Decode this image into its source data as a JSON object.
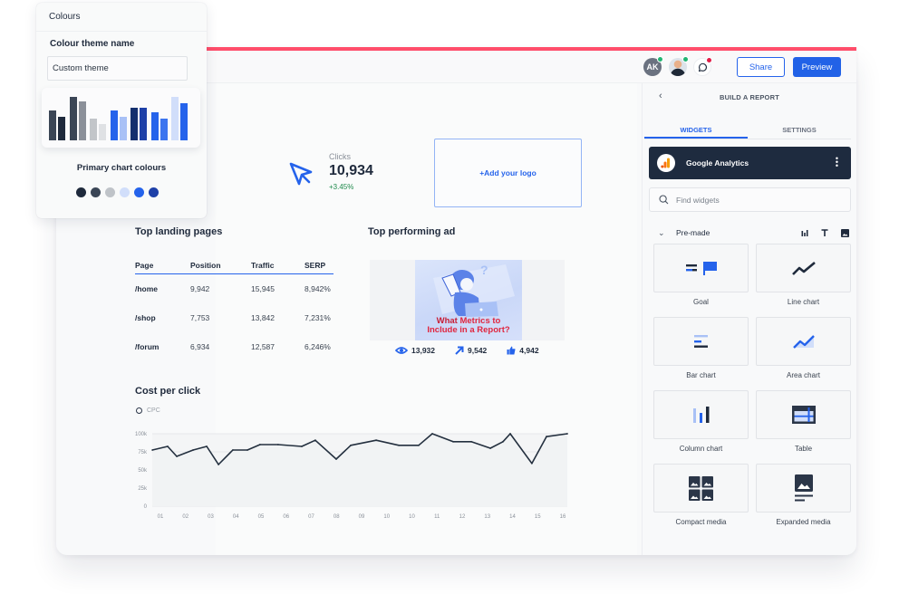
{
  "colours_panel": {
    "title": "Colours",
    "theme_name_label": "Colour theme name",
    "theme_name_value": "Custom theme",
    "preview_bars": [
      {
        "value": 0.5,
        "color": "#3b4656"
      },
      {
        "value": 0.4,
        "color": "#1f2a3c"
      },
      {
        "value": 0.73,
        "color": "#3b4656"
      },
      {
        "value": 0.66,
        "color": "#8b9099"
      },
      {
        "value": 0.36,
        "color": "#c2c5c9"
      },
      {
        "value": 0.28,
        "color": "#dfe1e4"
      },
      {
        "value": 0.5,
        "color": "#2563eb"
      },
      {
        "value": 0.4,
        "color": "#a9c1f6"
      },
      {
        "value": 0.55,
        "color": "#14306e"
      },
      {
        "value": 0.55,
        "color": "#1e40a8"
      },
      {
        "value": 0.47,
        "color": "#2563eb"
      },
      {
        "value": 0.37,
        "color": "#3b74ef"
      },
      {
        "value": 0.73,
        "color": "#d1defa"
      },
      {
        "value": 0.63,
        "color": "#2563eb"
      }
    ],
    "primary_label": "Primary chart colours",
    "swatches": [
      "#1f2a3c",
      "#3b4656",
      "#bfc3c8",
      "#d1defa",
      "#2563eb",
      "#1e40a8"
    ]
  },
  "header": {
    "avatar_initials": "AK",
    "share_label": "Share",
    "preview_label": "Preview",
    "accent_color": "#ff4d6a"
  },
  "kpi": {
    "icon": "cursor-icon",
    "label": "Clicks",
    "value": "10,934",
    "change": "+3.45%"
  },
  "logo_placeholder": "+Add your logo",
  "landing_pages": {
    "title": "Top landing pages",
    "columns": [
      "Page",
      "Position",
      "Traffic",
      "SERP"
    ],
    "rows": [
      [
        "/home",
        "9,942",
        "15,945",
        "8,942%"
      ],
      [
        "/shop",
        "7,753",
        "13,842",
        "7,231%"
      ],
      [
        "/forum",
        "6,934",
        "12,587",
        "6,246%"
      ]
    ]
  },
  "top_ad": {
    "title": "Top performing ad",
    "image_text_line1_a": "What ",
    "image_text_line1_b": "Metrics to",
    "image_text_line2": "Include in a Report?",
    "stats": [
      {
        "icon": "eye-icon",
        "value": "13,932"
      },
      {
        "icon": "arrow-up-right-icon",
        "value": "9,542"
      },
      {
        "icon": "thumbs-up-icon",
        "value": "4,942"
      }
    ]
  },
  "chart_data": {
    "type": "line",
    "title": "Cost per click",
    "legend": [
      "CPC"
    ],
    "legend_position": "top-left",
    "xlabel": "",
    "ylabel": "",
    "categories": [
      "01",
      "02",
      "03",
      "04",
      "05",
      "06",
      "07",
      "08",
      "09",
      "10",
      "10",
      "11",
      "12",
      "13",
      "14",
      "15",
      "16"
    ],
    "y_ticks": [
      "0",
      "25k",
      "50k",
      "75k",
      "100k"
    ],
    "ylim": [
      0,
      100000
    ],
    "grid": true,
    "series": [
      {
        "name": "CPC",
        "x": [
          -0.32,
          0.29,
          0.65,
          1.3,
          1.84,
          2.31,
          2.88,
          3.46,
          3.96,
          4.68,
          5.62,
          6.16,
          6.99,
          7.57,
          8.58,
          9.48,
          10.27,
          10.81,
          11.64,
          12.36,
          13.12,
          13.62,
          13.91,
          14.77,
          15.35,
          16.18
        ],
        "values": [
          77500,
          82500,
          68750,
          77500,
          82500,
          57500,
          77500,
          77500,
          85000,
          85000,
          82500,
          91000,
          65000,
          84000,
          91000,
          84000,
          84000,
          100000,
          89000,
          89000,
          80000,
          89000,
          100000,
          59000,
          96000,
          100000
        ]
      }
    ]
  },
  "panel": {
    "title": "BUILD A REPORT",
    "tabs": [
      "WIDGETS",
      "SETTINGS"
    ],
    "active_tab": "WIDGETS",
    "source_name": "Google Analytics",
    "search_placeholder": "Find widgets",
    "section_label": "Pre-made",
    "widgets": [
      {
        "label": "Goal",
        "icon": "goal-icon"
      },
      {
        "label": "Line chart",
        "icon": "line-chart-icon"
      },
      {
        "label": "Bar chart",
        "icon": "bar-chart-icon"
      },
      {
        "label": "Area chart",
        "icon": "area-chart-icon"
      },
      {
        "label": "Column chart",
        "icon": "column-chart-icon"
      },
      {
        "label": "Table",
        "icon": "table-icon"
      },
      {
        "label": "Compact media",
        "icon": "compact-media-icon"
      },
      {
        "label": "Expanded media",
        "icon": "expanded-media-icon"
      }
    ]
  }
}
